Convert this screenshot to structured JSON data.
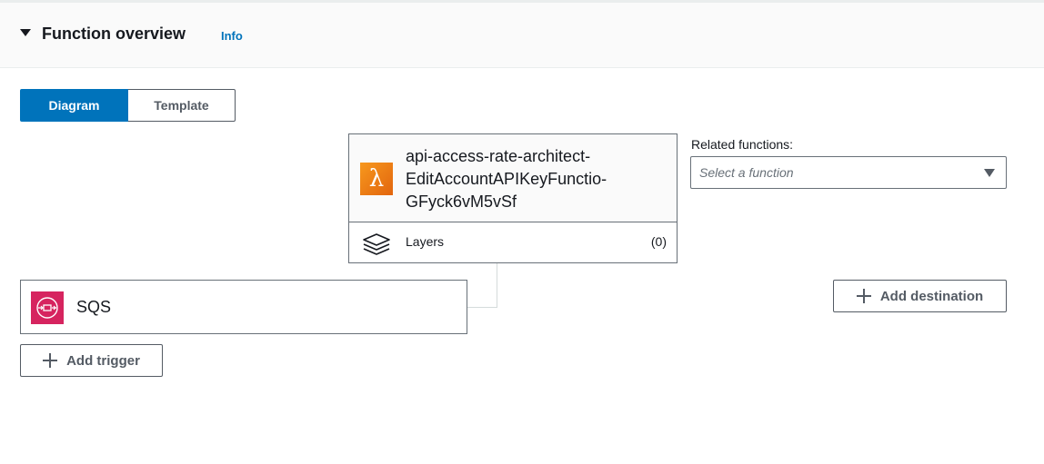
{
  "header": {
    "title": "Function overview",
    "info_label": "Info"
  },
  "view_toggle": {
    "active_label": "Diagram",
    "inactive_label": "Template"
  },
  "function": {
    "icon": "lambda-icon",
    "icon_color": "#ed7100",
    "name_lines": [
      "api-access-rate-architect-",
      "EditAccountAPIKeyFunctio-",
      "GFyck6vM5vSf"
    ],
    "layers_label": "Layers",
    "layers_count": "(0)"
  },
  "related": {
    "label": "Related functions:",
    "placeholder": "Select a function"
  },
  "trigger": {
    "icon": "sqs-icon",
    "icon_color": "#d6245f",
    "label": "SQS"
  },
  "buttons": {
    "add_trigger": "Add trigger",
    "add_destination": "Add destination"
  },
  "colors": {
    "accent": "#0073bb",
    "text": "#16191f",
    "border": "#687078"
  }
}
